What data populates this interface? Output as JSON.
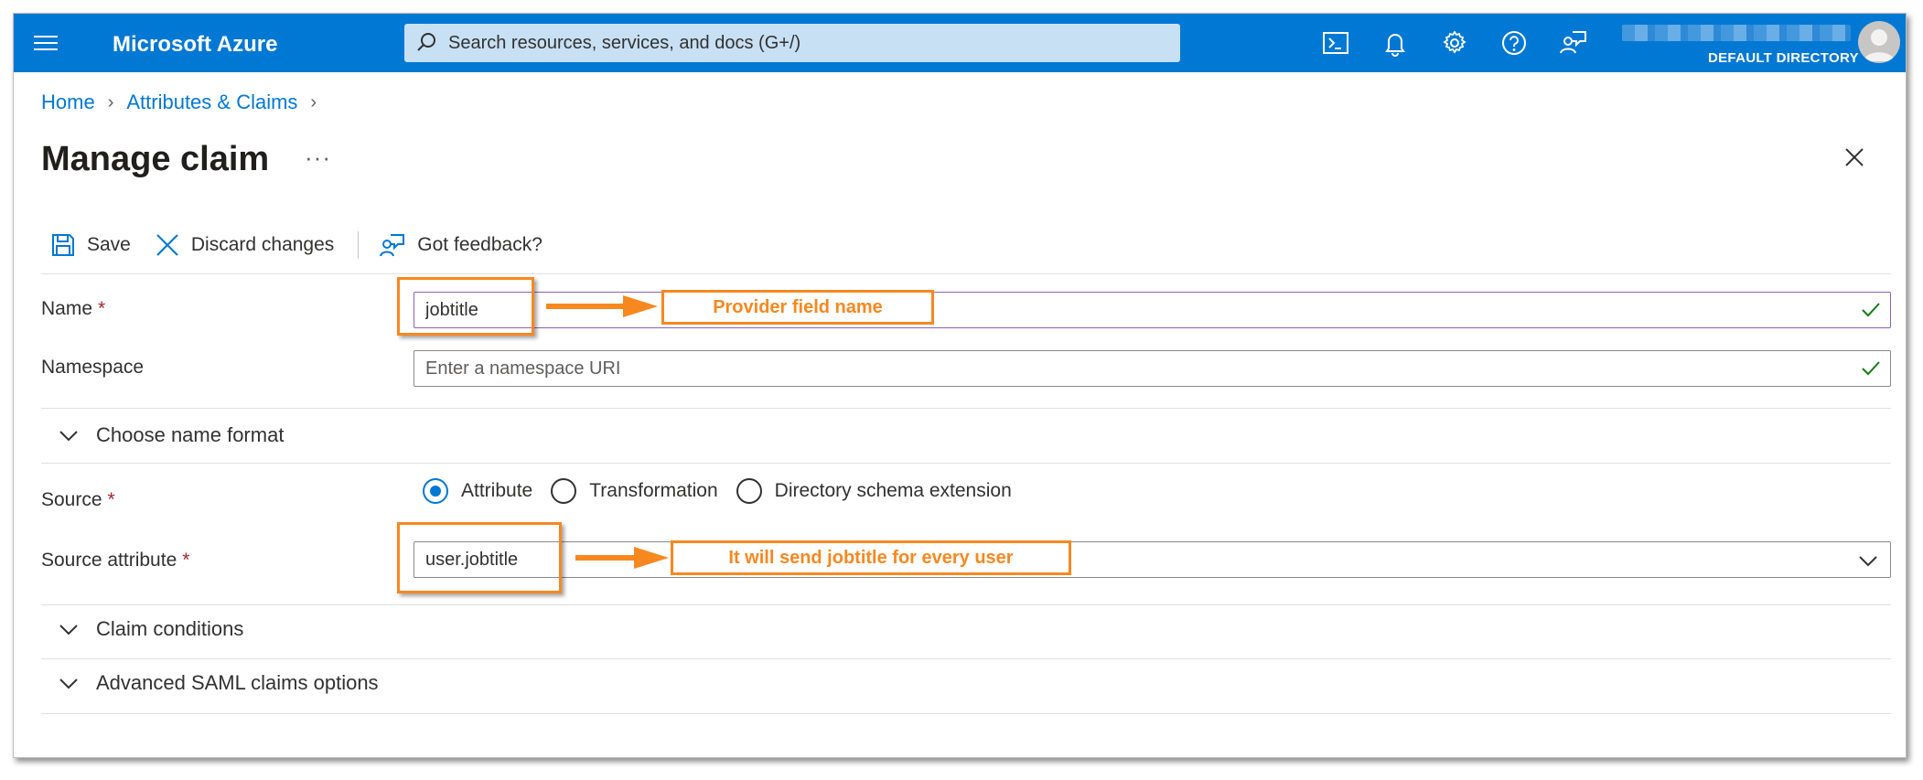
{
  "topbar": {
    "brand": "Microsoft Azure",
    "search_placeholder": "Search resources, services, and docs (G+/)",
    "directory": "DEFAULT DIRECTORY",
    "icons": [
      "cloud-shell-icon",
      "notifications-icon",
      "settings-icon",
      "help-icon",
      "feedback-icon"
    ]
  },
  "breadcrumb": {
    "items": [
      "Home",
      "Attributes & Claims"
    ]
  },
  "page": {
    "title": "Manage claim",
    "more": "···"
  },
  "toolbar": {
    "save_label": "Save",
    "discard_label": "Discard changes",
    "feedback_label": "Got feedback?"
  },
  "form": {
    "name_label": "Name",
    "name_value": "jobtitle",
    "namespace_label": "Namespace",
    "namespace_placeholder": "Enter a namespace URI",
    "choose_name_format": "Choose name format",
    "source_label": "Source",
    "source_options": [
      "Attribute",
      "Transformation",
      "Directory schema extension"
    ],
    "source_selected": "Attribute",
    "source_attribute_label": "Source attribute",
    "source_attribute_value": "user.jobtitle",
    "claim_conditions": "Claim conditions",
    "advanced_saml": "Advanced SAML claims options",
    "required_marker": "*"
  },
  "annotations": {
    "name_callout": "Provider field name",
    "source_callout": "It will send jobtitle for every user"
  },
  "colors": {
    "azure_blue": "#0078d4",
    "annotation_orange": "#f7881f",
    "required_red": "#a4262c",
    "success_green": "#107c10"
  }
}
